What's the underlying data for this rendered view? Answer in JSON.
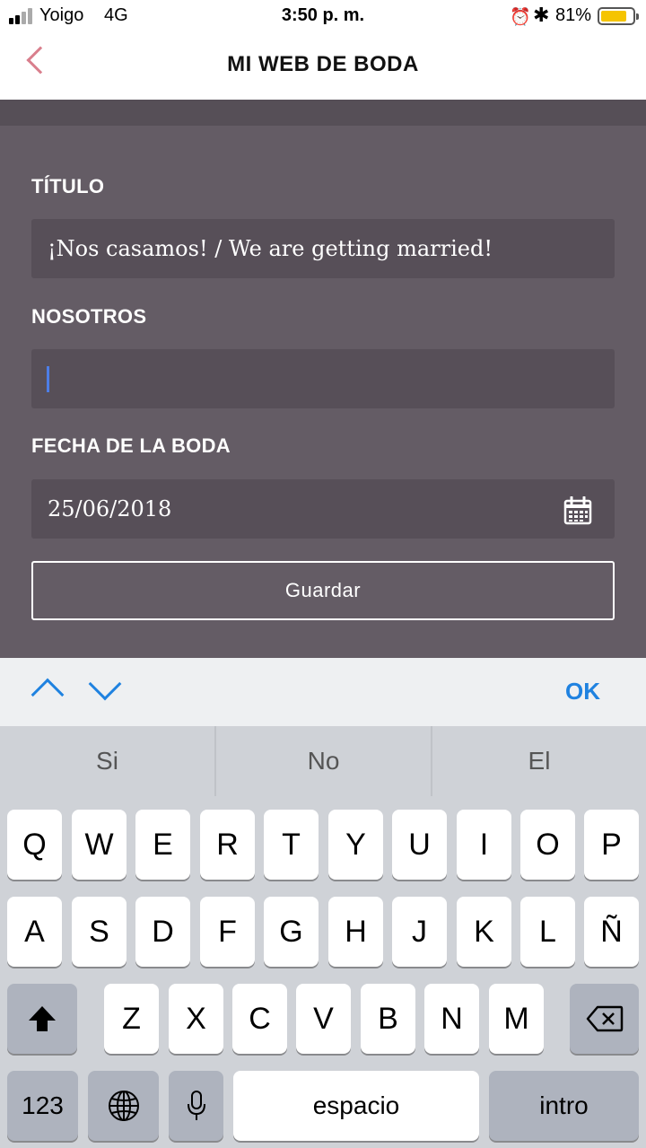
{
  "status_bar": {
    "carrier": "Yoigo",
    "network": "4G",
    "time": "3:50 p. m.",
    "battery_percent": "81%",
    "battery_level": 0.81
  },
  "header": {
    "title": "MI WEB DE BODA"
  },
  "form": {
    "title_label": "TÍTULO",
    "title_value": "¡Nos casamos! / We are getting married!",
    "about_label": "NOSOTROS",
    "about_value": "",
    "date_label": "FECHA DE LA BODA",
    "date_value": "25/06/2018",
    "save_label": "Guardar"
  },
  "accessory_bar": {
    "done_label": "OK"
  },
  "suggestions": [
    "Si",
    "No",
    "El"
  ],
  "keyboard": {
    "row1": [
      "Q",
      "W",
      "E",
      "R",
      "T",
      "Y",
      "U",
      "I",
      "O",
      "P"
    ],
    "row2": [
      "A",
      "S",
      "D",
      "F",
      "G",
      "H",
      "J",
      "K",
      "L",
      "Ñ"
    ],
    "row3": [
      "Z",
      "X",
      "C",
      "V",
      "B",
      "N",
      "M"
    ],
    "numbers_label": "123",
    "space_label": "espacio",
    "return_label": "intro"
  },
  "colors": {
    "accent": "#1f82e0",
    "back_arrow": "#d97f8d",
    "form_bg": "#645c65",
    "field_bg": "#574f58"
  }
}
